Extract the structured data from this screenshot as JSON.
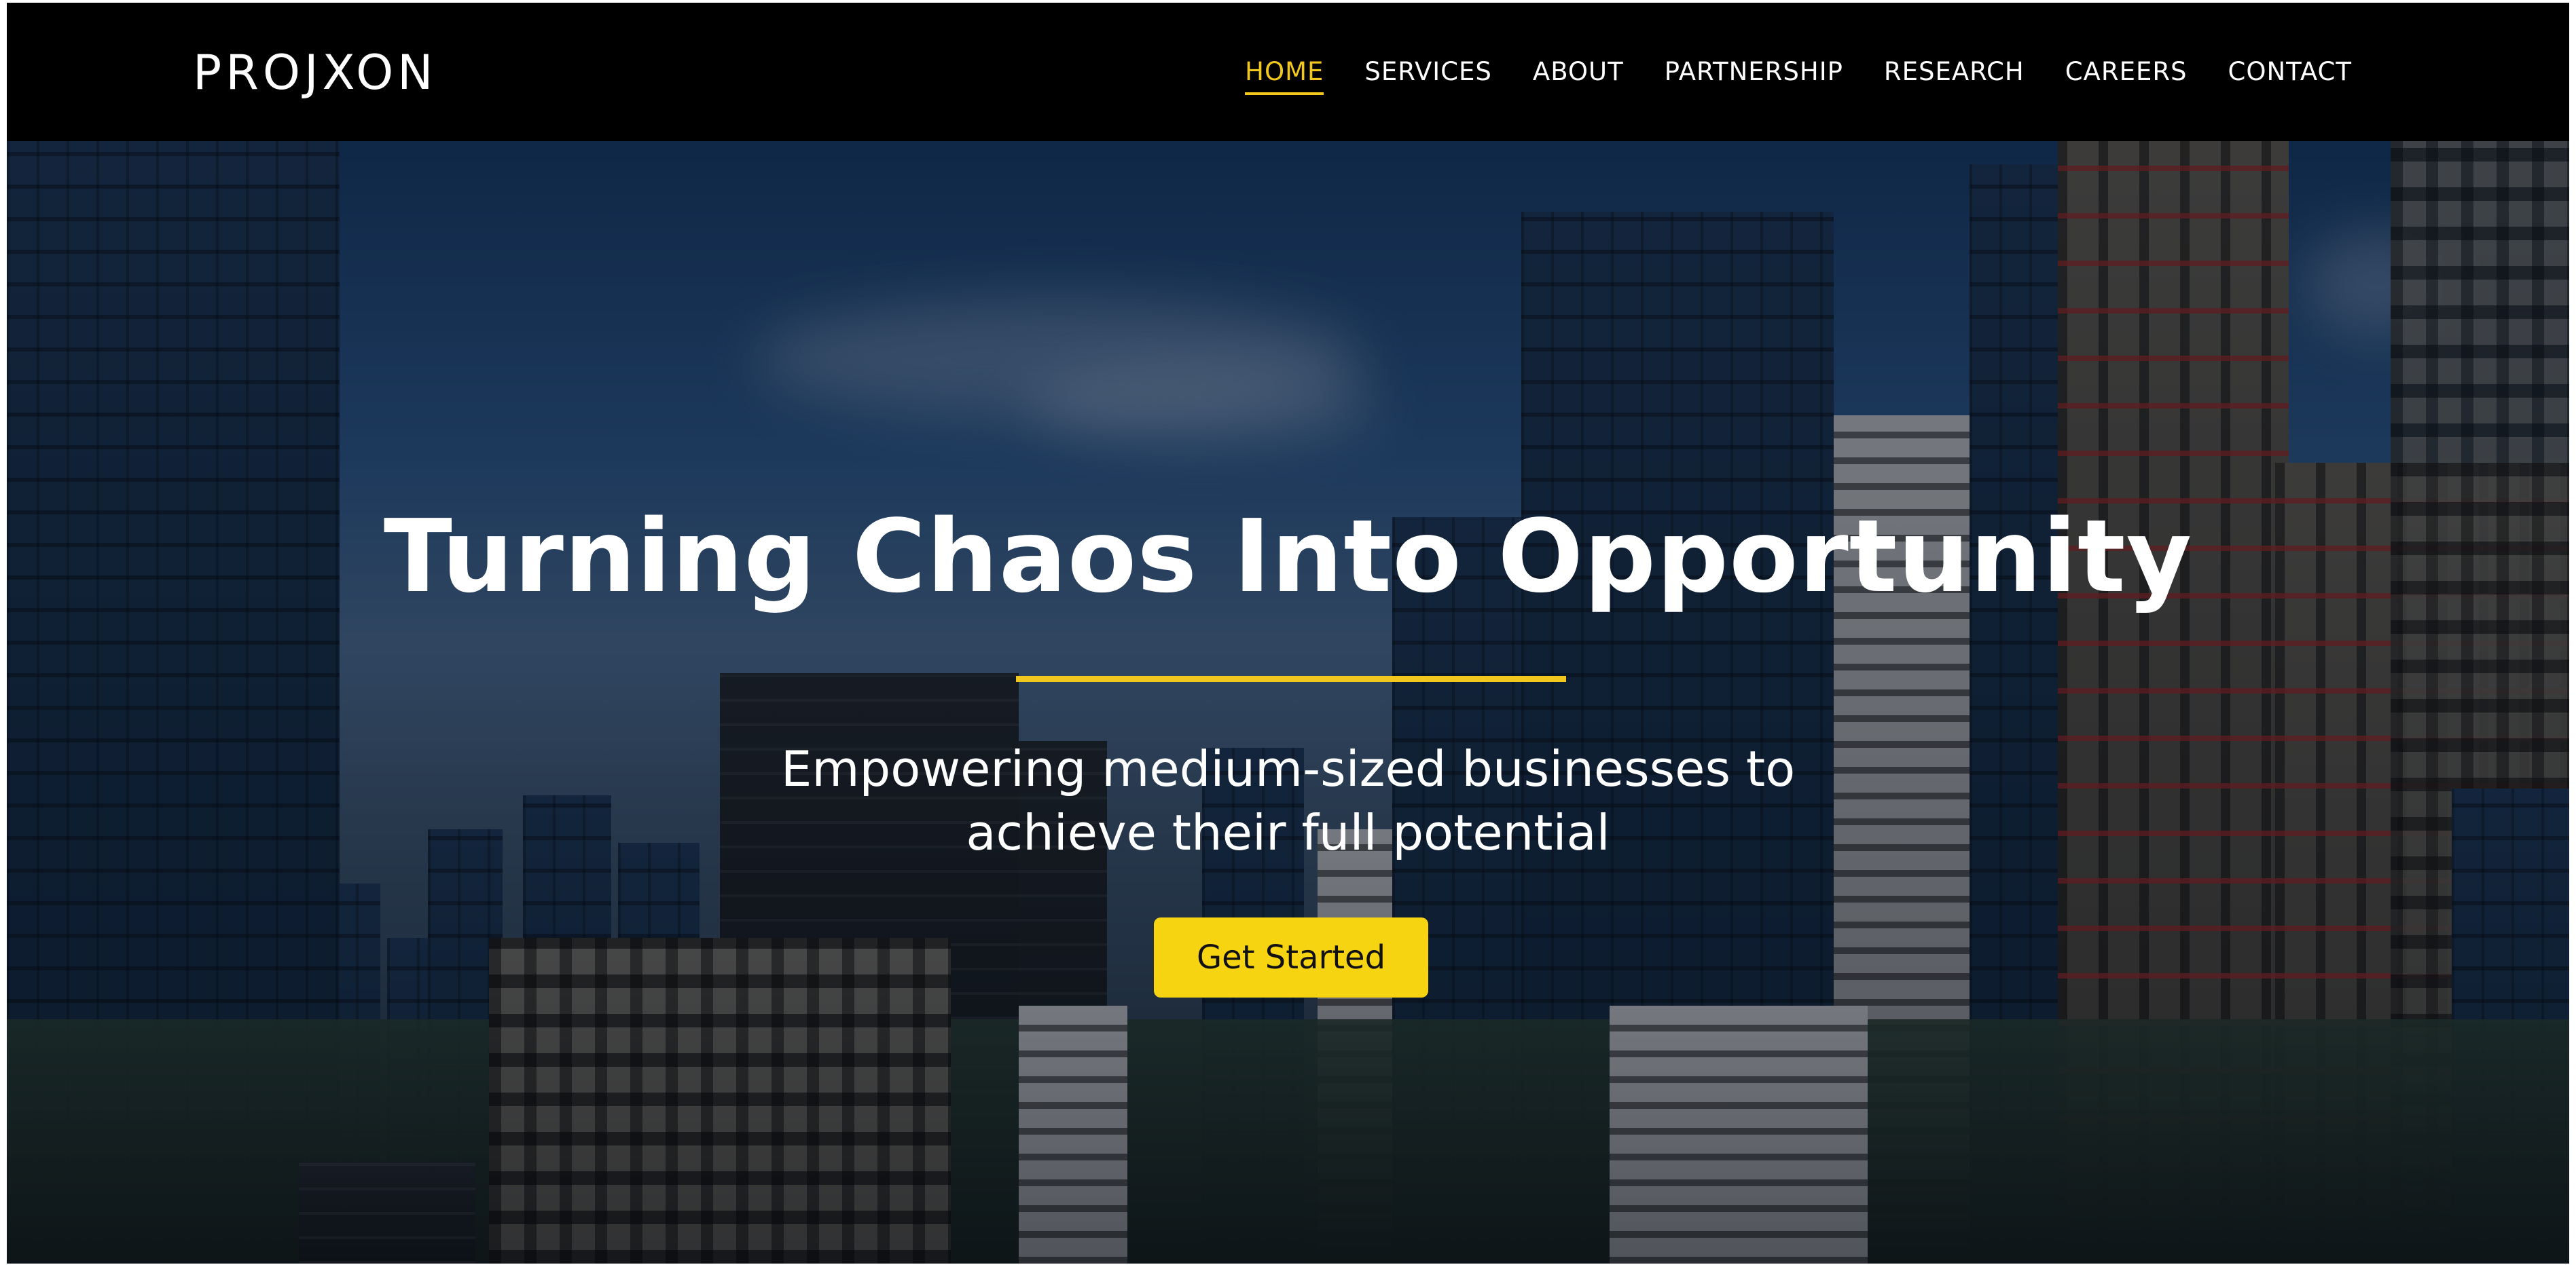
{
  "brand": {
    "logo_text": "PROJXON"
  },
  "nav": {
    "items": [
      {
        "label": "HOME",
        "active": true
      },
      {
        "label": "SERVICES",
        "active": false
      },
      {
        "label": "ABOUT",
        "active": false
      },
      {
        "label": "PARTNERSHIP",
        "active": false
      },
      {
        "label": "RESEARCH",
        "active": false
      },
      {
        "label": "CAREERS",
        "active": false
      },
      {
        "label": "CONTACT",
        "active": false
      }
    ]
  },
  "hero": {
    "headline": "Turning Chaos Into Opportunity",
    "subheadline_line1": "Empowering medium-sized businesses to",
    "subheadline_line2": "achieve their full potential",
    "cta_label": "Get Started"
  },
  "colors": {
    "accent": "#f2c81f",
    "button": "#f7d411",
    "nav_background": "#000000",
    "text": "#ffffff"
  }
}
